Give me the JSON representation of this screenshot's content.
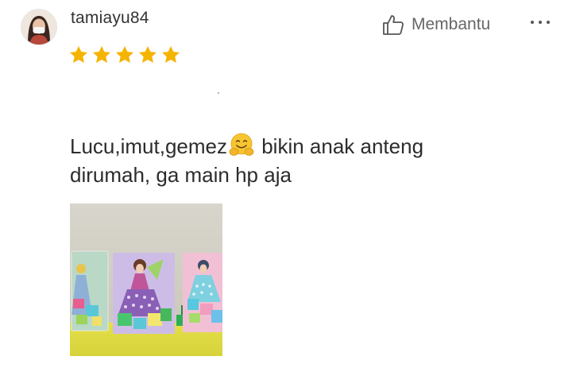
{
  "review": {
    "username": "tamiayu84",
    "rating": 5,
    "rating_max": 5,
    "helpful_label": "Membantu",
    "text_line1_before_emoji": "Lucu,imut,gemez",
    "text_line1_after_emoji": " bikin anak anteng",
    "text_line2": "dirumah, ga main hp aja"
  },
  "icons": {
    "avatar": "user-avatar",
    "star": "star-icon",
    "helpful": "thumbs-up-icon",
    "more": "more-horizontal-icon",
    "emoji": "hugging-face-emoji"
  },
  "colors": {
    "star": "#F5B400",
    "text": "#2C2C2C",
    "muted": "#666666",
    "emoji": "#F7C531"
  }
}
